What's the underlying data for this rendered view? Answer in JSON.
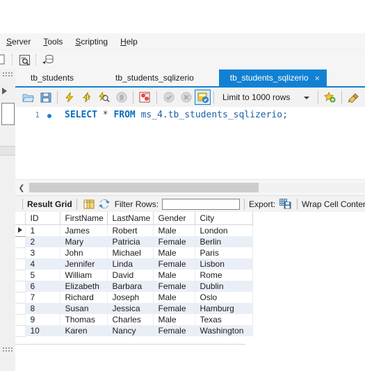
{
  "menubar": {
    "items": [
      {
        "label": "Server",
        "mnemonic": "S"
      },
      {
        "label": "Tools",
        "mnemonic": "T"
      },
      {
        "label": "Scripting",
        "mnemonic": "S"
      },
      {
        "label": "Help",
        "mnemonic": "H"
      }
    ]
  },
  "main_toolbar": {
    "icons": [
      {
        "name": "new-query-icon"
      },
      {
        "name": "inspect-schema-icon"
      },
      {
        "name": "reconnect-server-icon"
      }
    ]
  },
  "tabs": [
    {
      "label": "tb_students",
      "active": false,
      "closable": false
    },
    {
      "label": "tb_students_sqlizerio",
      "active": false,
      "closable": false
    },
    {
      "label": "tb_students_sqlizerio",
      "active": true,
      "closable": true,
      "close_glyph": "×"
    }
  ],
  "editor_toolbar": {
    "buttons": [
      {
        "name": "open-script-icon",
        "title": "Open a SQL script file"
      },
      {
        "name": "save-script-icon",
        "title": "Save script"
      },
      {
        "name": "execute-statement-icon",
        "title": "Execute"
      },
      {
        "name": "execute-current-statement-icon",
        "title": "Execute current statement"
      },
      {
        "name": "explain-query-icon",
        "title": "Explain"
      },
      {
        "name": "stop-execution-icon",
        "title": "Stop"
      },
      {
        "name": "toggle-stop-on-error-icon",
        "title": "Toggle stop on error"
      },
      {
        "name": "commit-transaction-icon",
        "title": "Commit"
      },
      {
        "name": "rollback-transaction-icon",
        "title": "Rollback"
      },
      {
        "name": "toggle-autocommit-icon",
        "title": "Toggle autocommit",
        "selected": true
      }
    ],
    "limit_label": "Limit to 1000 rows",
    "right_icons": [
      {
        "name": "add-snippet-icon"
      },
      {
        "name": "beautify-sql-icon"
      },
      {
        "name": "find-icon"
      }
    ]
  },
  "editor": {
    "line_number": "1",
    "breakpoint_marker": "●",
    "query": "SELECT * FROM ms_4.tb_students_sqlizerio;",
    "tokens": [
      {
        "text": "SELECT",
        "type": "keyword"
      },
      {
        "text": " ",
        "type": "plain"
      },
      {
        "text": "*",
        "type": "operator"
      },
      {
        "text": " ",
        "type": "plain"
      },
      {
        "text": "FROM",
        "type": "keyword"
      },
      {
        "text": " ",
        "type": "plain"
      },
      {
        "text": "ms_4.tb_students_sqlizerio;",
        "type": "identifier"
      }
    ]
  },
  "scrollbar": {
    "left_chevron": "❮"
  },
  "grid_toolbar": {
    "result_grid_label": "Result Grid",
    "grid-view-icon": "grid-view-icon",
    "refresh-icon": "refresh-icon",
    "filter_label": "Filter Rows:",
    "filter_value": "",
    "filter_placeholder": "",
    "export_label": "Export:",
    "export-icon": "export-icon",
    "wrap_label": "Wrap Cell Content:",
    "wrap-icon": "wrap-cell-content-icon"
  },
  "grid": {
    "columns": [
      "ID",
      "FirstName",
      "LastName",
      "Gender",
      "City"
    ],
    "rows": [
      {
        "id": "1",
        "first": "James",
        "last": "Robert",
        "gender": "Male",
        "city": "London"
      },
      {
        "id": "2",
        "first": "Mary",
        "last": "Patricia",
        "gender": "Female",
        "city": "Berlin"
      },
      {
        "id": "3",
        "first": "John",
        "last": "Michael",
        "gender": "Male",
        "city": "Paris"
      },
      {
        "id": "4",
        "first": "Jennifer",
        "last": "Linda",
        "gender": "Female",
        "city": "Lisbon"
      },
      {
        "id": "5",
        "first": "William",
        "last": "David",
        "gender": "Male",
        "city": "Rome"
      },
      {
        "id": "6",
        "first": "Elizabeth",
        "last": "Barbara",
        "gender": "Female",
        "city": "Dublin"
      },
      {
        "id": "7",
        "first": "Richard",
        "last": "Joseph",
        "gender": "Male",
        "city": "Oslo"
      },
      {
        "id": "8",
        "first": "Susan",
        "last": "Jessica",
        "gender": "Female",
        "city": "Hamburg"
      },
      {
        "id": "9",
        "first": "Thomas",
        "last": "Charles",
        "gender": "Male",
        "city": "Texas"
      },
      {
        "id": "10",
        "first": "Karen",
        "last": "Nancy",
        "gender": "Female",
        "city": "Washington"
      }
    ],
    "current_row_index": 0
  },
  "colors": {
    "accent": "#1281d3",
    "tab_active_bg": "#1281d3",
    "row_alt_bg": "#eaeff7",
    "keyword": "#0a6fc2",
    "chrome_bg": "#f2f2f2"
  }
}
